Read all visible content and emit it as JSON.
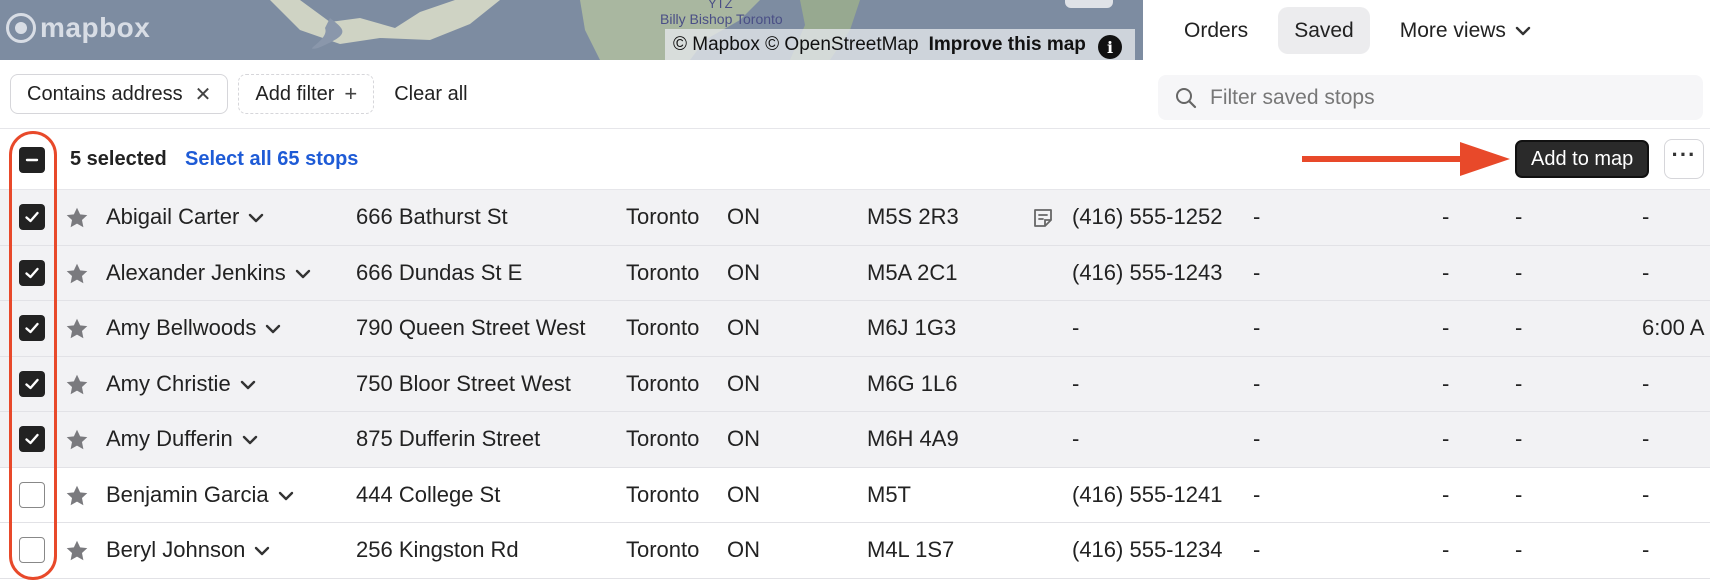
{
  "map": {
    "logo_text": "mapbox",
    "label_top": "YTZ",
    "label_place": "Billy Bishop Toronto",
    "attribution_mapbox": "© Mapbox",
    "attribution_osm": "© OpenStreetMap",
    "attribution_improve": "Improve this map",
    "info_symbol": "i"
  },
  "tabs": [
    {
      "label": "Orders"
    },
    {
      "label": "Saved"
    },
    {
      "label": "More views"
    }
  ],
  "filters": {
    "chip_label": "Contains address",
    "add_filter_label": "Add filter",
    "clear_all_label": "Clear all"
  },
  "search": {
    "placeholder": "Filter saved stops",
    "value": ""
  },
  "selection": {
    "count_label": "5 selected",
    "select_all_label": "Select all 65 stops",
    "add_to_map_label": "Add to map",
    "more_label": "···"
  },
  "colors": {
    "annotation": "#e8492a",
    "link": "#1e5bd6",
    "selected_row": "#f2f2f4"
  },
  "rows": [
    {
      "selected": true,
      "name": "Abigail Carter",
      "address": "666 Bathurst St",
      "city": "Toronto",
      "province": "ON",
      "postal": "M5S 2R3",
      "has_note": true,
      "phone": "(416) 555-1252",
      "c1": "-",
      "c2": "-",
      "c3": "-",
      "c4": "-"
    },
    {
      "selected": true,
      "name": "Alexander Jenkins",
      "address": "666 Dundas St E",
      "city": "Toronto",
      "province": "ON",
      "postal": "M5A 2C1",
      "has_note": false,
      "phone": "(416) 555-1243",
      "c1": "-",
      "c2": "-",
      "c3": "-",
      "c4": "-"
    },
    {
      "selected": true,
      "name": "Amy Bellwoods",
      "address": "790 Queen Street West",
      "city": "Toronto",
      "province": "ON",
      "postal": "M6J 1G3",
      "has_note": false,
      "phone": "-",
      "c1": "-",
      "c2": "-",
      "c3": "-",
      "c4": "6:00 A"
    },
    {
      "selected": true,
      "name": "Amy Christie",
      "address": "750 Bloor Street West",
      "city": "Toronto",
      "province": "ON",
      "postal": "M6G 1L6",
      "has_note": false,
      "phone": "-",
      "c1": "-",
      "c2": "-",
      "c3": "-",
      "c4": "-"
    },
    {
      "selected": true,
      "name": "Amy Dufferin",
      "address": "875 Dufferin Street",
      "city": "Toronto",
      "province": "ON",
      "postal": "M6H 4A9",
      "has_note": false,
      "phone": "-",
      "c1": "-",
      "c2": "-",
      "c3": "-",
      "c4": "-"
    },
    {
      "selected": false,
      "name": "Benjamin Garcia",
      "address": "444 College St",
      "city": "Toronto",
      "province": "ON",
      "postal": "M5T",
      "has_note": false,
      "phone": "(416) 555-1241",
      "c1": "-",
      "c2": "-",
      "c3": "-",
      "c4": "-"
    },
    {
      "selected": false,
      "name": "Beryl Johnson",
      "address": "256 Kingston Rd",
      "city": "Toronto",
      "province": "ON",
      "postal": "M4L 1S7",
      "has_note": false,
      "phone": "(416) 555-1234",
      "c1": "-",
      "c2": "-",
      "c3": "-",
      "c4": "-"
    }
  ]
}
